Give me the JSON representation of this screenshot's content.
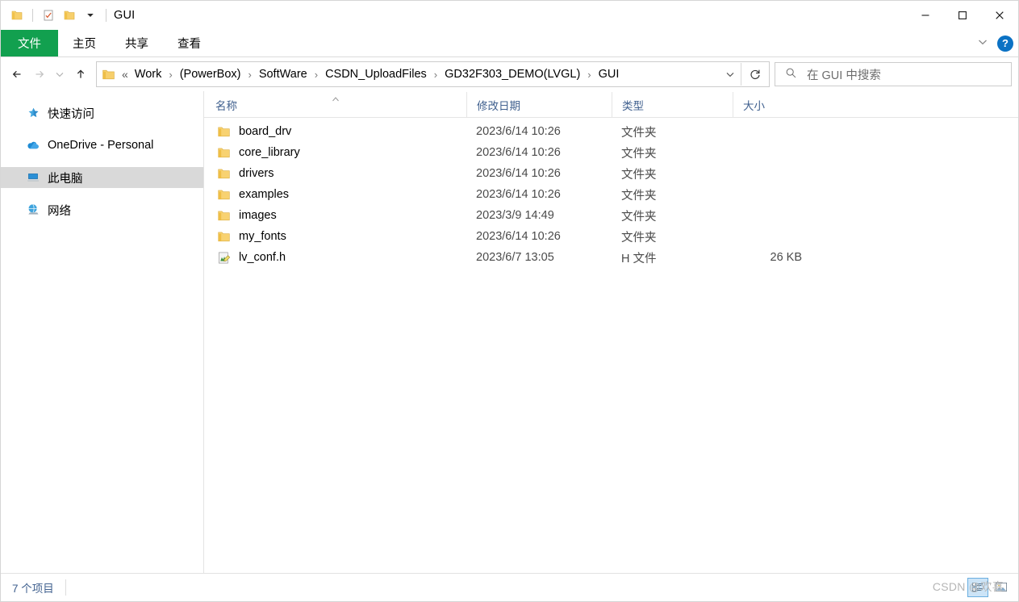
{
  "window": {
    "title": "GUI",
    "quick_access": [
      {
        "name": "folder-icon",
        "label": "文件夹"
      },
      {
        "name": "properties-icon",
        "label": "属性"
      },
      {
        "name": "new-folder-icon",
        "label": "新建文件夹"
      },
      {
        "name": "chevron-down-icon",
        "label": "自定义快速访问工具栏"
      }
    ],
    "controls": {
      "minimize": "—",
      "maximize": "□",
      "close": "✕"
    }
  },
  "ribbon": {
    "tabs": [
      {
        "label": "文件",
        "active_file": true
      },
      {
        "label": "主页",
        "active_file": false
      },
      {
        "label": "共享",
        "active_file": false
      },
      {
        "label": "查看",
        "active_file": false
      }
    ],
    "file_tab_color": "#12a04f",
    "collapse_label": "⌄",
    "help_label": "?"
  },
  "address": {
    "back_label": "←",
    "forward_label": "→",
    "history_label": "⌄",
    "up_label": "↑",
    "ellipsis": "«",
    "separator": "›",
    "crumbs": [
      "Work",
      "(PowerBox)",
      "SoftWare",
      "CSDN_UploadFiles",
      "GD32F303_DEMO(LVGL)",
      "GUI"
    ],
    "dropdown_label": "⌄",
    "refresh_label": "↻"
  },
  "search": {
    "placeholder": "在 GUI 中搜索",
    "value": ""
  },
  "sidebar": {
    "items": [
      {
        "label": "快速访问",
        "icon": "star-pin-icon",
        "selected": false
      },
      {
        "label": "OneDrive - Personal",
        "icon": "cloud-icon",
        "selected": false
      },
      {
        "label": "此电脑",
        "icon": "computer-icon",
        "selected": true
      },
      {
        "label": "网络",
        "icon": "network-icon",
        "selected": false
      }
    ]
  },
  "list": {
    "columns": [
      {
        "label": "名称",
        "sorted": true,
        "sort_dir": "asc"
      },
      {
        "label": "修改日期",
        "sorted": false,
        "sort_dir": ""
      },
      {
        "label": "类型",
        "sorted": false,
        "sort_dir": ""
      },
      {
        "label": "大小",
        "sorted": false,
        "sort_dir": ""
      }
    ],
    "rows": [
      {
        "name": "board_drv",
        "date": "2023/6/14 10:26",
        "type": "文件夹",
        "size": "",
        "icon": "folder-icon"
      },
      {
        "name": "core_library",
        "date": "2023/6/14 10:26",
        "type": "文件夹",
        "size": "",
        "icon": "folder-icon"
      },
      {
        "name": "drivers",
        "date": "2023/6/14 10:26",
        "type": "文件夹",
        "size": "",
        "icon": "folder-icon"
      },
      {
        "name": "examples",
        "date": "2023/6/14 10:26",
        "type": "文件夹",
        "size": "",
        "icon": "folder-icon"
      },
      {
        "name": "images",
        "date": "2023/3/9 14:49",
        "type": "文件夹",
        "size": "",
        "icon": "folder-icon"
      },
      {
        "name": "my_fonts",
        "date": "2023/6/14 10:26",
        "type": "文件夹",
        "size": "",
        "icon": "folder-icon"
      },
      {
        "name": "lv_conf.h",
        "date": "2023/6/7 13:05",
        "type": "H 文件",
        "size": "26 KB",
        "icon": "header-file-icon"
      }
    ]
  },
  "status": {
    "item_count": "7 个项目",
    "view_details_label": "详细信息",
    "view_large_icons_label": "大图标"
  },
  "watermark": {
    "text": "CSDN @欢喜"
  }
}
